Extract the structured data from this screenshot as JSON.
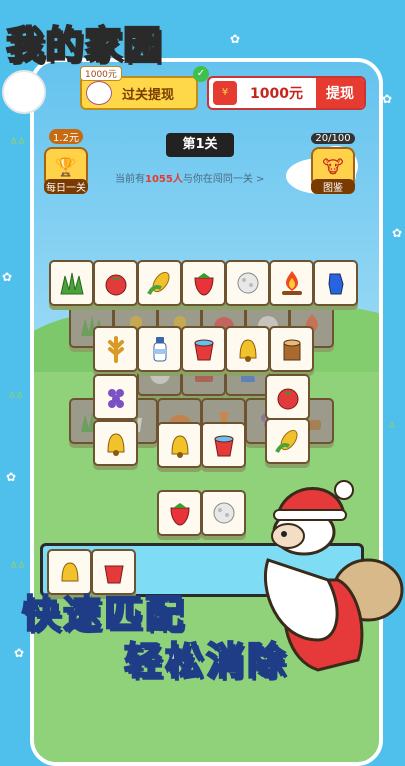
{
  "app_title": "我的家园",
  "top_bar": {
    "withdraw_banner_tag": "1000元",
    "withdraw_banner_label": "过关提现",
    "balance": "1000元",
    "withdraw_button": "提现"
  },
  "daily": {
    "reward": "1.2元",
    "label": "每日一关"
  },
  "collection": {
    "count": "20/100",
    "label": "图鉴"
  },
  "level_label": "第1关",
  "peer_text": {
    "prefix": "当前有",
    "count": "1055人",
    "suffix": "与你在闯同一关 >"
  },
  "slogans": [
    "快速匹配",
    "轻松消除"
  ],
  "tile_icons": [
    "grass-icon",
    "tomato-icon",
    "corn-icon",
    "strawberry-icon",
    "cotton-icon",
    "campfire-icon",
    "glove-icon",
    "wheat-icon",
    "milk-icon",
    "bucket-icon",
    "bell-icon",
    "stump-icon",
    "grapes-icon",
    "carrot-icon",
    "pumpkin-icon"
  ]
}
